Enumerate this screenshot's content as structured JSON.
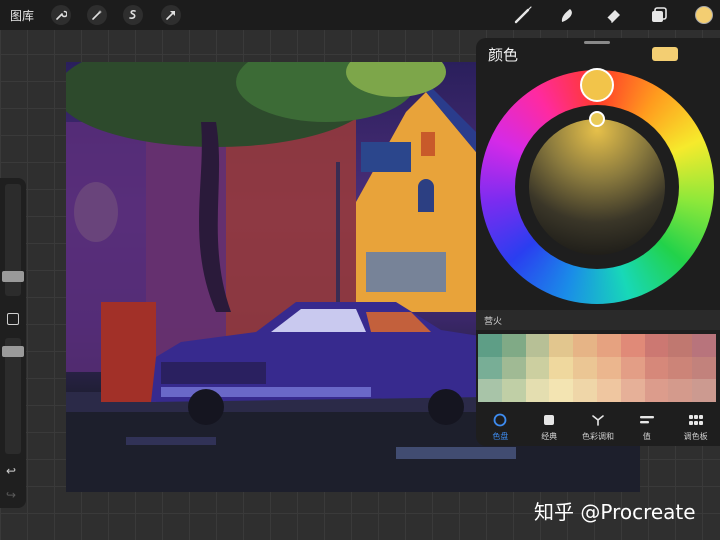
{
  "toolbar": {
    "gallery_label": "图库",
    "left_tools": [
      "wrench-icon",
      "magic-wand-icon",
      "selection-icon",
      "transform-icon"
    ],
    "right_tools": [
      "brush-icon",
      "smudge-icon",
      "eraser-icon",
      "layers-icon"
    ],
    "current_color": "#f3ce72"
  },
  "color_panel": {
    "title": "颜色",
    "current_color": "#f3ce72",
    "ring_colors": [
      "#ff3a2a",
      "#ff9b1e",
      "#f6ea2c",
      "#8de83a",
      "#22d24a",
      "#18d8b8",
      "#1a8ce8",
      "#2a3ef0",
      "#7a2cf0",
      "#d42ae8",
      "#ff2aa0"
    ],
    "palette_name": "营火",
    "palette_colors": [
      "#5e9e86",
      "#80aa86",
      "#b7c096",
      "#e2c68e",
      "#e6b486",
      "#e6a280",
      "#e08a78",
      "#cc7872",
      "#c07870",
      "#b8747c",
      "#78ae96",
      "#a0ba94",
      "#cccfa0",
      "#efd89e",
      "#ebc694",
      "#ebb68e",
      "#e39e86",
      "#d6887a",
      "#cc8478",
      "#c2827c",
      "#a8c4a8",
      "#c0cfa6",
      "#e4deb0",
      "#f3e4b2",
      "#efd6a8",
      "#efc6a0",
      "#e6b098",
      "#dc9c8c",
      "#d49a8c",
      "#cc9a90"
    ],
    "modes": [
      {
        "label": "色盘",
        "icon": "color-disc-icon",
        "active": true
      },
      {
        "label": "经典",
        "icon": "classic-square-icon",
        "active": false
      },
      {
        "label": "色彩调和",
        "icon": "harmony-icon",
        "active": false
      },
      {
        "label": "值",
        "icon": "value-sliders-icon",
        "active": false
      },
      {
        "label": "调色板",
        "icon": "palette-grid-icon",
        "active": false
      }
    ]
  },
  "watermark": "知乎 @Procreate"
}
